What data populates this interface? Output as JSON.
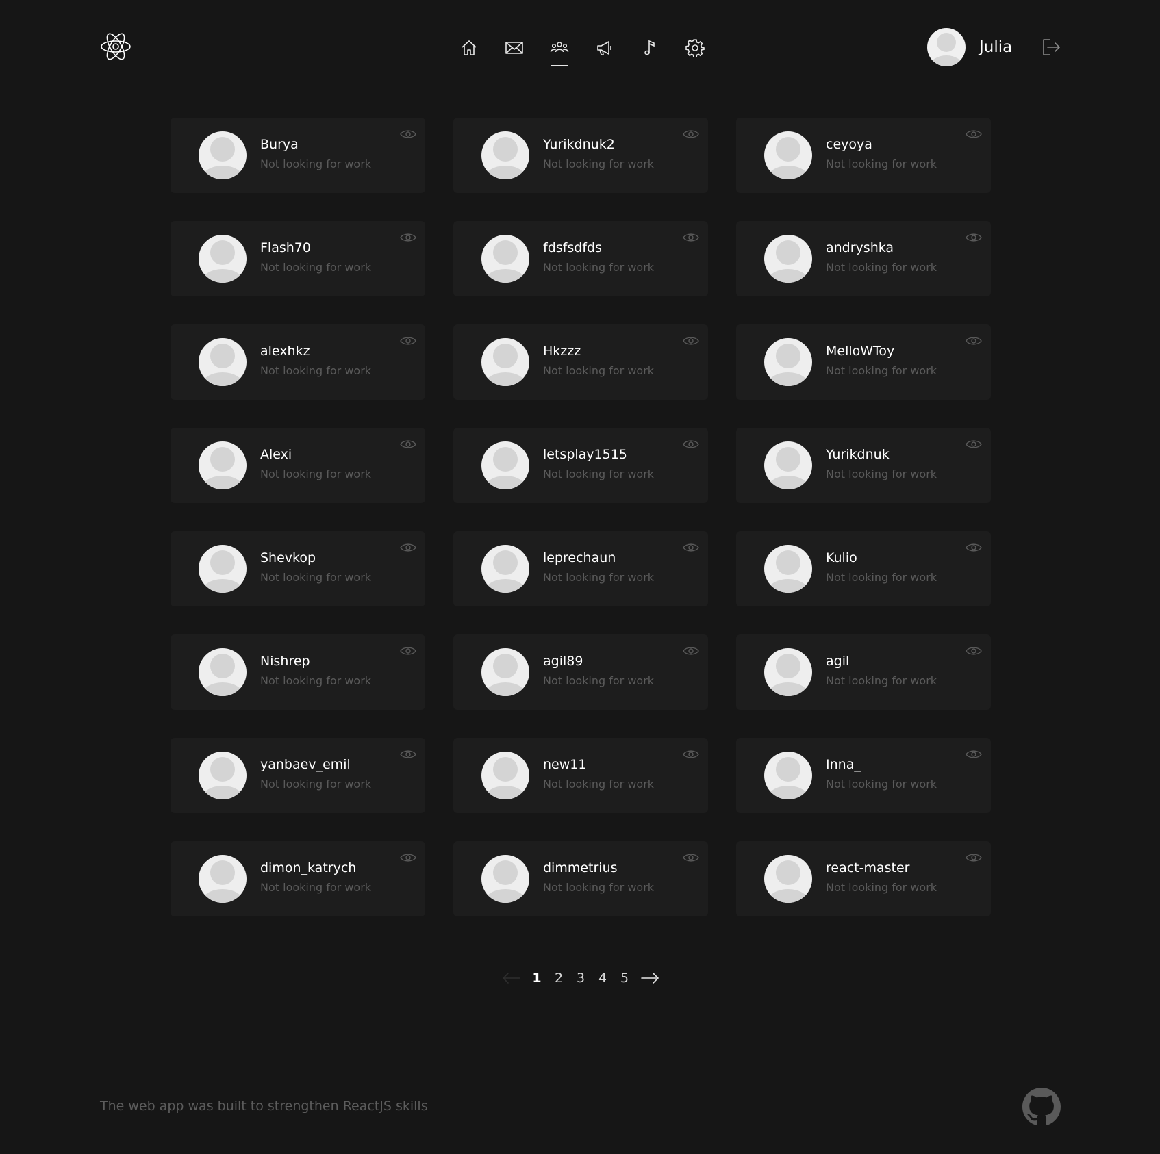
{
  "header": {
    "logo_icon": "atom-logo-icon",
    "nav": [
      {
        "icon": "home-icon",
        "active": false
      },
      {
        "icon": "mail-icon",
        "active": false
      },
      {
        "icon": "users-icon",
        "active": true
      },
      {
        "icon": "megaphone-icon",
        "active": false
      },
      {
        "icon": "music-icon",
        "active": false
      },
      {
        "icon": "gear-icon",
        "active": false
      }
    ],
    "user_name": "Julia",
    "logout_icon": "logout-icon"
  },
  "users": [
    {
      "name": "Burya",
      "status": "Not looking for work"
    },
    {
      "name": "Yurikdnuk2",
      "status": "Not looking for work"
    },
    {
      "name": "ceyoya",
      "status": "Not looking for work"
    },
    {
      "name": "Flash70",
      "status": "Not looking for work"
    },
    {
      "name": "fdsfsdfds",
      "status": "Not looking for work"
    },
    {
      "name": "andryshka",
      "status": "Not looking for work"
    },
    {
      "name": "alexhkz",
      "status": "Not looking for work"
    },
    {
      "name": "Hkzzz",
      "status": "Not looking for work"
    },
    {
      "name": "MelloWToy",
      "status": "Not looking for work"
    },
    {
      "name": "Alexi",
      "status": "Not looking for work"
    },
    {
      "name": "letsplay1515",
      "status": "Not looking for work"
    },
    {
      "name": "Yurikdnuk",
      "status": "Not looking for work"
    },
    {
      "name": "Shevkop",
      "status": "Not looking for work"
    },
    {
      "name": "leprechaun",
      "status": "Not looking for work"
    },
    {
      "name": "Kulio",
      "status": "Not looking for work"
    },
    {
      "name": "Nishrep",
      "status": "Not looking for work"
    },
    {
      "name": "agil89",
      "status": "Not looking for work"
    },
    {
      "name": "agil",
      "status": "Not looking for work"
    },
    {
      "name": "yanbaev_emil",
      "status": "Not looking for work"
    },
    {
      "name": "new11",
      "status": "Not looking for work"
    },
    {
      "name": "Inna_",
      "status": "Not looking for work"
    },
    {
      "name": "dimon_katrych",
      "status": "Not looking for work"
    },
    {
      "name": "dimmetrius",
      "status": "Not looking for work"
    },
    {
      "name": "react-master",
      "status": "Not looking for work"
    }
  ],
  "pagination": {
    "pages": [
      "1",
      "2",
      "3",
      "4",
      "5"
    ],
    "current": "1",
    "prev_icon": "arrow-left-icon",
    "next_icon": "arrow-right-icon"
  },
  "footer": {
    "text": "The web app was built to strengthen ReactJS skills",
    "github_icon": "github-icon"
  },
  "colors": {
    "background": "#161616",
    "card": "#1d1d1d",
    "text_primary": "#ffffff",
    "text_muted": "#5a5a5a"
  }
}
